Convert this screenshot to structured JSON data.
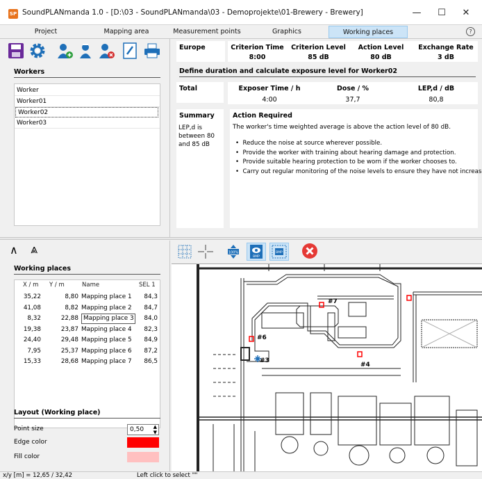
{
  "window": {
    "title": "SoundPLANmanda 1.0 - [D:\\03 - SoundPLANmanda\\03 - Demoprojekte\\01-Brewery - Brewery]",
    "app_icon_text": "SP",
    "minimize": "—",
    "maximize": "☐",
    "close": "✕"
  },
  "menu": {
    "tabs": [
      {
        "label": "Project"
      },
      {
        "label": "Mapping area"
      },
      {
        "label": "Measurement points"
      },
      {
        "label": "Graphics"
      },
      {
        "label": "Working places"
      }
    ],
    "active_tab": "Working places",
    "help": "?"
  },
  "toolbar": {
    "icons": [
      "save-icon",
      "settings-gear-icon",
      "add-worker-icon",
      "worker-group-icon",
      "delete-worker-icon",
      "edit-icon",
      "print-icon"
    ]
  },
  "workers": {
    "title": "Workers",
    "header": "Worker",
    "items": [
      "Worker01",
      "Worker02",
      "Worker03"
    ],
    "selected": "Worker02"
  },
  "europe": {
    "label": "Europe",
    "columns": [
      "Criterion Time",
      "Criterion Level",
      "Action Level",
      "Exchange Rate"
    ],
    "values": [
      "8:00",
      "85 dB",
      "80 dB",
      "3 dB"
    ]
  },
  "define": {
    "heading": "Define duration and calculate exposure level for Worker02"
  },
  "total": {
    "label": "Total",
    "columns": [
      "Exposer Time / h",
      "Dose / %",
      "LEP,d / dB"
    ],
    "values": [
      "4:00",
      "37,7",
      "80,8"
    ]
  },
  "summary": {
    "label": "Summary",
    "text": "LEP,d is between 80 and 85 dB",
    "action_title": "Action Required",
    "action_text": "The worker's time weighted average is above the action level of 80 dB.",
    "bullets": [
      "Reduce the noise at source wherever possible.",
      "Provide the worker with training about hearing damage and protection.",
      "Provide suitable hearing protection to be worn if the worker chooses to.",
      "Carry out regular monitoring of the noise levels to ensure they have not increased."
    ]
  },
  "collapse": {
    "up": "∧",
    "up_double": "⩓"
  },
  "working_places": {
    "title": "Working places",
    "columns": [
      "X / m",
      "Y / m",
      "Name",
      "SEL 1"
    ],
    "rows": [
      {
        "x": "35,22",
        "y": "8,80",
        "name": "Mapping place 1",
        "sel": "84,3"
      },
      {
        "x": "41,08",
        "y": "8,82",
        "name": "Mapping place 2",
        "sel": "84,7"
      },
      {
        "x": "8,32",
        "y": "22,88",
        "name": "Mapping place 3",
        "sel": "84,0"
      },
      {
        "x": "19,38",
        "y": "23,87",
        "name": "Mapping place 4",
        "sel": "82,3"
      },
      {
        "x": "24,40",
        "y": "29,48",
        "name": "Mapping place 5",
        "sel": "84,9"
      },
      {
        "x": "7,95",
        "y": "25,37",
        "name": "Mapping place 6",
        "sel": "87,2"
      },
      {
        "x": "15,33",
        "y": "28,68",
        "name": "Mapping place 7",
        "sel": "86,5"
      }
    ],
    "selected_name": "Mapping place 3"
  },
  "layout": {
    "title": "Layout (Working place)",
    "point_size_label": "Point size",
    "point_size_value": "0,50",
    "edge_color_label": "Edge color",
    "edge_color": "#ff0000",
    "fill_color_label": "Fill color",
    "fill_color": "#ffc0c0"
  },
  "map_toolbar": {
    "icons": [
      "grid-icon",
      "crosshair-icon",
      "zoom-100-icon",
      "bmp-view-icon",
      "bmp-select-icon",
      "close-red-icon"
    ],
    "zoom_label": "100%",
    "bmp_label": "BMP"
  },
  "map": {
    "markers": [
      "#7",
      "#6",
      "#3",
      "#4"
    ]
  },
  "status": {
    "coords": "x/y [m] = 12,65 / 32,42",
    "hint": "Left click to select \"\""
  },
  "colors": {
    "active_tab": "#cce4f7",
    "marker": "#ff0000",
    "close_red": "#e53935"
  }
}
